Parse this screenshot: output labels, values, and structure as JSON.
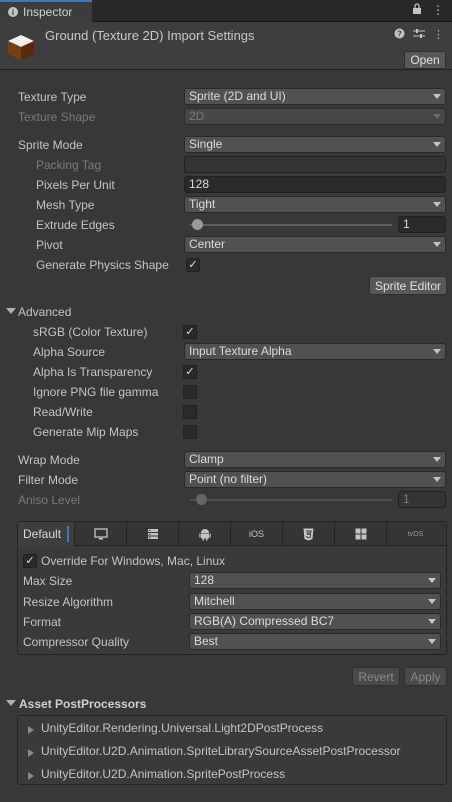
{
  "tab": {
    "label": "Inspector"
  },
  "header": {
    "title": "Ground (Texture 2D) Import Settings",
    "open_label": "Open"
  },
  "fields": {
    "texture_type": {
      "label": "Texture Type",
      "value": "Sprite (2D and UI)"
    },
    "texture_shape": {
      "label": "Texture Shape",
      "value": "2D"
    },
    "sprite_mode": {
      "label": "Sprite Mode",
      "value": "Single"
    },
    "packing_tag": {
      "label": "Packing Tag",
      "value": ""
    },
    "pixels_per_unit": {
      "label": "Pixels Per Unit",
      "value": "128"
    },
    "mesh_type": {
      "label": "Mesh Type",
      "value": "Tight"
    },
    "extrude_edges": {
      "label": "Extrude Edges",
      "value": "1",
      "level": 0.0
    },
    "pivot": {
      "label": "Pivot",
      "value": "Center"
    },
    "generate_physics_shape": {
      "label": "Generate Physics Shape",
      "checked": true
    },
    "sprite_editor_label": "Sprite Editor"
  },
  "advanced": {
    "title": "Advanced",
    "srgb": {
      "label": "sRGB (Color Texture)",
      "checked": true
    },
    "alpha_source": {
      "label": "Alpha Source",
      "value": "Input Texture Alpha"
    },
    "alpha_is_transparency": {
      "label": "Alpha Is Transparency",
      "checked": true
    },
    "ignore_png_gamma": {
      "label": "Ignore PNG file gamma",
      "checked": false
    },
    "read_write": {
      "label": "Read/Write",
      "checked": false
    },
    "generate_mip_maps": {
      "label": "Generate Mip Maps",
      "checked": false
    }
  },
  "wrap_mode": {
    "label": "Wrap Mode",
    "value": "Clamp"
  },
  "filter_mode": {
    "label": "Filter Mode",
    "value": "Point (no filter)"
  },
  "aniso_level": {
    "label": "Aniso Level",
    "value": "1",
    "level": 0.0
  },
  "platforms": {
    "tabs": [
      "Default",
      "monitor-icon",
      "server-icon",
      "android-icon",
      "iOS",
      "html5-icon",
      "windows-icon",
      "tvOS"
    ],
    "override": {
      "label": "Override For Windows, Mac, Linux",
      "checked": true
    },
    "max_size": {
      "label": "Max Size",
      "value": "128"
    },
    "resize_algorithm": {
      "label": "Resize Algorithm",
      "value": "Mitchell"
    },
    "format": {
      "label": "Format",
      "value": "RGB(A) Compressed BC7"
    },
    "compressor_quality": {
      "label": "Compressor Quality",
      "value": "Best"
    }
  },
  "buttons": {
    "revert": "Revert",
    "apply": "Apply"
  },
  "postprocessors": {
    "title": "Asset PostProcessors",
    "items": [
      "UnityEditor.Rendering.Universal.Light2DPostProcess",
      "UnityEditor.U2D.Animation.SpriteLibrarySourceAssetPostProcessor",
      "UnityEditor.U2D.Animation.SpritePostProcess"
    ]
  }
}
